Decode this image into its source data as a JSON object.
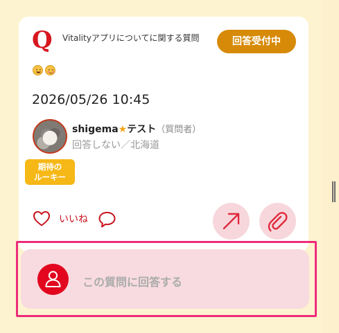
{
  "question": {
    "logo_letter": "Q",
    "category": "Vitalityアプリについてに関する質問",
    "status": "回答受付中",
    "reactions": [
      "grinning-face-emoji",
      "blushing-face-emoji"
    ],
    "datetime": "2026/05/26 10:45"
  },
  "user": {
    "name_prefix": "shigema",
    "name_star": "★",
    "name_suffix": "テスト",
    "role": "（質問者）",
    "meta": "回答しない／北海道",
    "badge_line1": "期待の",
    "badge_line2": "ルーキー"
  },
  "actions": {
    "like_label": "いいね",
    "icons": [
      "heart-icon",
      "comment-icon",
      "share-icon",
      "attachment-icon"
    ]
  },
  "answer": {
    "label": "この質問に回答する",
    "icon": "person-icon"
  },
  "colors": {
    "background": "#fef3d0",
    "brand_red": "#d8161f",
    "status_badge": "#d78a07",
    "rookie_badge": "#f6b817",
    "action_circle": "#f7d7dc",
    "answer_highlight": "#ee2c7b"
  }
}
